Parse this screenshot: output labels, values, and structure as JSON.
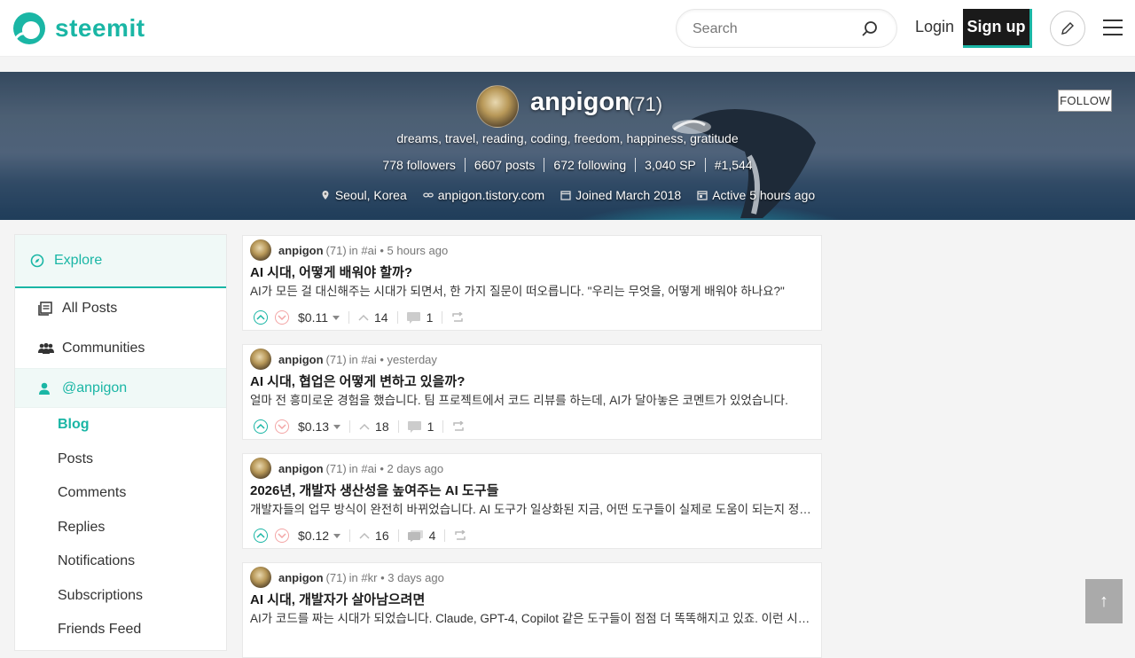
{
  "header": {
    "logo_text": "steemit",
    "search_placeholder": "Search",
    "login_label": "Login",
    "signup_label": "Sign up",
    "brand_color": "#1ab6a5"
  },
  "profile": {
    "name": "anpigon",
    "reputation": "(71)",
    "bio": "dreams, travel, reading, coding, freedom, happiness, gratitude",
    "stats": [
      "778 followers",
      "6607 posts",
      "672 following",
      "3,040 SP",
      "#1,544"
    ],
    "location": "Seoul, Korea",
    "website": "anpigon.tistory.com",
    "joined": "Joined March 2018",
    "active": "Active 5 hours ago",
    "follow_label": "FOLLOW"
  },
  "sidebar": {
    "explore_label": "Explore",
    "items": [
      {
        "label": "All Posts",
        "icon": "posts-icon"
      },
      {
        "label": "Communities",
        "icon": "communities-icon"
      },
      {
        "label": "@anpigon",
        "icon": "user-icon"
      }
    ],
    "sub_items": [
      "Blog",
      "Posts",
      "Comments",
      "Replies",
      "Notifications",
      "Subscriptions",
      "Friends Feed"
    ]
  },
  "posts": [
    {
      "author": "anpigon",
      "rep": "(71)",
      "community": "in #ai",
      "time": "• 5 hours ago",
      "title": "AI 시대, 어떻게 배워야 할까?",
      "body": "AI가 모든 걸 대신해주는 시대가 되면서, 한 가지 질문이 떠오릅니다. \"우리는 무엇을, 어떻게 배워야 하나요?\"",
      "payout": "$0.11",
      "votes": "14",
      "comments": "1"
    },
    {
      "author": "anpigon",
      "rep": "(71)",
      "community": "in #ai",
      "time": "• yesterday",
      "title": "AI 시대, 협업은 어떻게 변하고 있을까?",
      "body": "얼마 전 흥미로운 경험을 했습니다. 팀 프로젝트에서 코드 리뷰를 하는데, AI가 달아놓은 코멘트가 있었습니다.",
      "payout": "$0.13",
      "votes": "18",
      "comments": "1"
    },
    {
      "author": "anpigon",
      "rep": "(71)",
      "community": "in #ai",
      "time": "• 2 days ago",
      "title": "2026년, 개발자 생산성을 높여주는 AI 도구들",
      "body": "개발자들의 업무 방식이 완전히 바뀌었습니다. AI 도구가 일상화된 지금, 어떤 도구들이 실제로 도움이 되는지 정리해봅니다.",
      "payout": "$0.12",
      "votes": "16",
      "comments": "4"
    },
    {
      "author": "anpigon",
      "rep": "(71)",
      "community": "in #kr",
      "time": "• 3 days ago",
      "title": "AI 시대, 개발자가 살아남으려면",
      "body": "AI가 코드를 짜는 시대가 되었습니다. Claude, GPT-4, Copilot 같은 도구들이 점점 더 똑똑해지고 있죠. 이런 시대에",
      "payout": "",
      "votes": "",
      "comments": ""
    }
  ],
  "scroll_top_label": "↑"
}
